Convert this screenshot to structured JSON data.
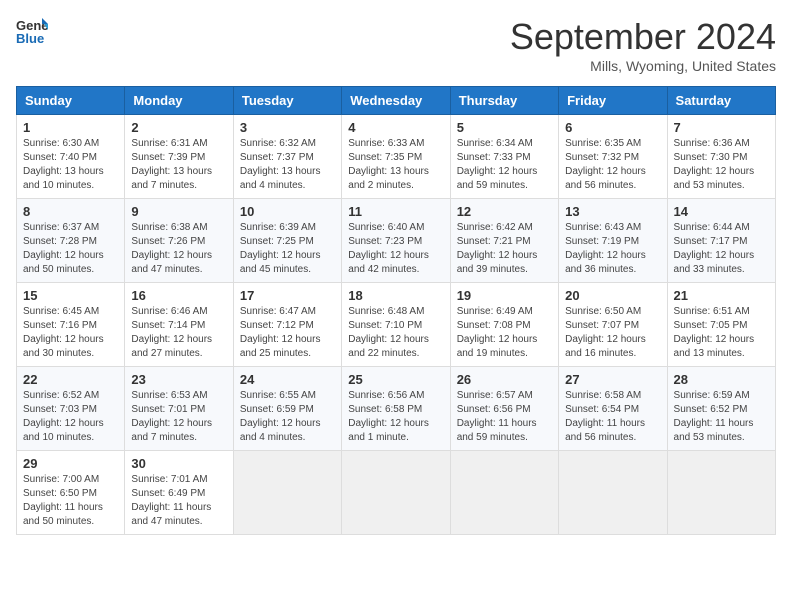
{
  "header": {
    "logo_line1": "General",
    "logo_line2": "Blue",
    "month": "September 2024",
    "location": "Mills, Wyoming, United States"
  },
  "weekdays": [
    "Sunday",
    "Monday",
    "Tuesday",
    "Wednesday",
    "Thursday",
    "Friday",
    "Saturday"
  ],
  "weeks": [
    [
      {
        "day": "1",
        "info": "Sunrise: 6:30 AM\nSunset: 7:40 PM\nDaylight: 13 hours and 10 minutes."
      },
      {
        "day": "2",
        "info": "Sunrise: 6:31 AM\nSunset: 7:39 PM\nDaylight: 13 hours and 7 minutes."
      },
      {
        "day": "3",
        "info": "Sunrise: 6:32 AM\nSunset: 7:37 PM\nDaylight: 13 hours and 4 minutes."
      },
      {
        "day": "4",
        "info": "Sunrise: 6:33 AM\nSunset: 7:35 PM\nDaylight: 13 hours and 2 minutes."
      },
      {
        "day": "5",
        "info": "Sunrise: 6:34 AM\nSunset: 7:33 PM\nDaylight: 12 hours and 59 minutes."
      },
      {
        "day": "6",
        "info": "Sunrise: 6:35 AM\nSunset: 7:32 PM\nDaylight: 12 hours and 56 minutes."
      },
      {
        "day": "7",
        "info": "Sunrise: 6:36 AM\nSunset: 7:30 PM\nDaylight: 12 hours and 53 minutes."
      }
    ],
    [
      {
        "day": "8",
        "info": "Sunrise: 6:37 AM\nSunset: 7:28 PM\nDaylight: 12 hours and 50 minutes."
      },
      {
        "day": "9",
        "info": "Sunrise: 6:38 AM\nSunset: 7:26 PM\nDaylight: 12 hours and 47 minutes."
      },
      {
        "day": "10",
        "info": "Sunrise: 6:39 AM\nSunset: 7:25 PM\nDaylight: 12 hours and 45 minutes."
      },
      {
        "day": "11",
        "info": "Sunrise: 6:40 AM\nSunset: 7:23 PM\nDaylight: 12 hours and 42 minutes."
      },
      {
        "day": "12",
        "info": "Sunrise: 6:42 AM\nSunset: 7:21 PM\nDaylight: 12 hours and 39 minutes."
      },
      {
        "day": "13",
        "info": "Sunrise: 6:43 AM\nSunset: 7:19 PM\nDaylight: 12 hours and 36 minutes."
      },
      {
        "day": "14",
        "info": "Sunrise: 6:44 AM\nSunset: 7:17 PM\nDaylight: 12 hours and 33 minutes."
      }
    ],
    [
      {
        "day": "15",
        "info": "Sunrise: 6:45 AM\nSunset: 7:16 PM\nDaylight: 12 hours and 30 minutes."
      },
      {
        "day": "16",
        "info": "Sunrise: 6:46 AM\nSunset: 7:14 PM\nDaylight: 12 hours and 27 minutes."
      },
      {
        "day": "17",
        "info": "Sunrise: 6:47 AM\nSunset: 7:12 PM\nDaylight: 12 hours and 25 minutes."
      },
      {
        "day": "18",
        "info": "Sunrise: 6:48 AM\nSunset: 7:10 PM\nDaylight: 12 hours and 22 minutes."
      },
      {
        "day": "19",
        "info": "Sunrise: 6:49 AM\nSunset: 7:08 PM\nDaylight: 12 hours and 19 minutes."
      },
      {
        "day": "20",
        "info": "Sunrise: 6:50 AM\nSunset: 7:07 PM\nDaylight: 12 hours and 16 minutes."
      },
      {
        "day": "21",
        "info": "Sunrise: 6:51 AM\nSunset: 7:05 PM\nDaylight: 12 hours and 13 minutes."
      }
    ],
    [
      {
        "day": "22",
        "info": "Sunrise: 6:52 AM\nSunset: 7:03 PM\nDaylight: 12 hours and 10 minutes."
      },
      {
        "day": "23",
        "info": "Sunrise: 6:53 AM\nSunset: 7:01 PM\nDaylight: 12 hours and 7 minutes."
      },
      {
        "day": "24",
        "info": "Sunrise: 6:55 AM\nSunset: 6:59 PM\nDaylight: 12 hours and 4 minutes."
      },
      {
        "day": "25",
        "info": "Sunrise: 6:56 AM\nSunset: 6:58 PM\nDaylight: 12 hours and 1 minute."
      },
      {
        "day": "26",
        "info": "Sunrise: 6:57 AM\nSunset: 6:56 PM\nDaylight: 11 hours and 59 minutes."
      },
      {
        "day": "27",
        "info": "Sunrise: 6:58 AM\nSunset: 6:54 PM\nDaylight: 11 hours and 56 minutes."
      },
      {
        "day": "28",
        "info": "Sunrise: 6:59 AM\nSunset: 6:52 PM\nDaylight: 11 hours and 53 minutes."
      }
    ],
    [
      {
        "day": "29",
        "info": "Sunrise: 7:00 AM\nSunset: 6:50 PM\nDaylight: 11 hours and 50 minutes."
      },
      {
        "day": "30",
        "info": "Sunrise: 7:01 AM\nSunset: 6:49 PM\nDaylight: 11 hours and 47 minutes."
      },
      {
        "day": "",
        "info": ""
      },
      {
        "day": "",
        "info": ""
      },
      {
        "day": "",
        "info": ""
      },
      {
        "day": "",
        "info": ""
      },
      {
        "day": "",
        "info": ""
      }
    ]
  ]
}
